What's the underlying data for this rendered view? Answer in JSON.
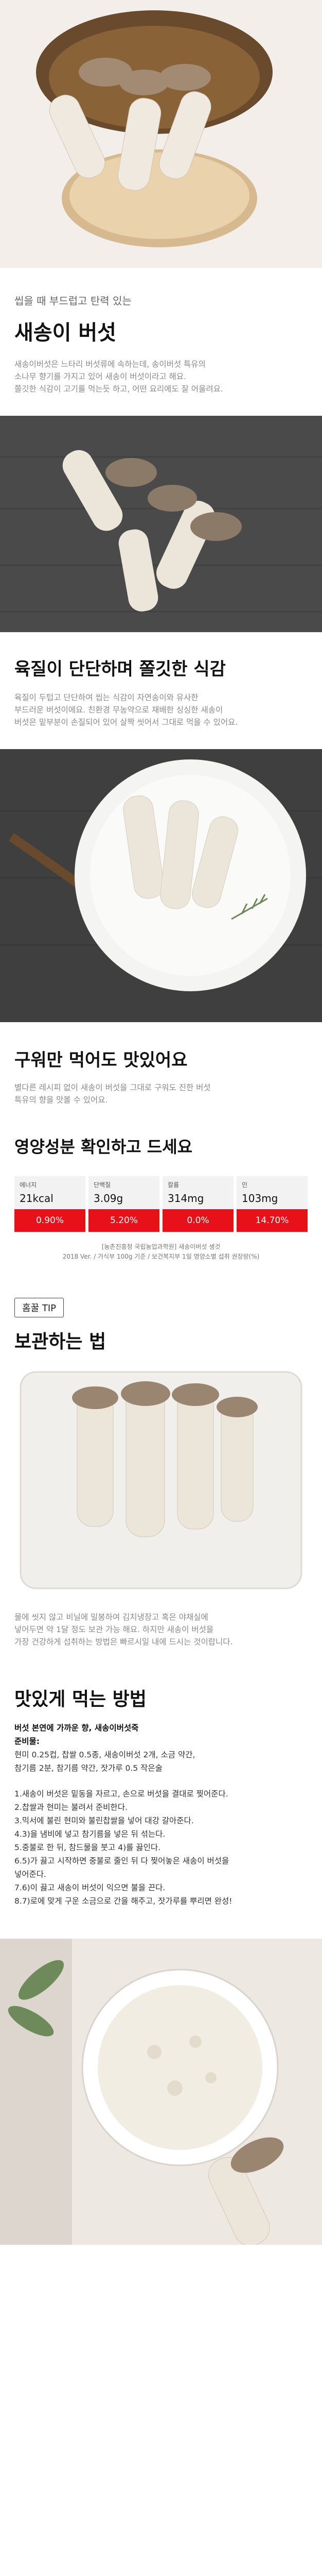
{
  "intro": {
    "subtitle": "씹을 때 부드럽고 탄력 있는",
    "title": "새송이 버섯",
    "desc": [
      "새송이버섯은 느타리 버섯류에 속하는데, 송이버섯 특유의",
      "소나무 향기를 가지고 있어 새송이 버섯이라고 해요.",
      "쫄깃한 식감이 고기를 먹는듯 하고, 어떤 요리에도 잘 어울려요."
    ]
  },
  "texture": {
    "title": "육질이 단단하며 쫄깃한 식감",
    "desc": [
      "육질이 두텁고 단단하여 씹는 식감이 자연송이와 유사한",
      "부드러운 버섯이에요. 친환경 무농약으로 재배한 싱싱한 새송이",
      "버섯은 밑부분이 손질되어 있어 살짝 씻어서 그대로 먹을 수 있어요."
    ]
  },
  "grill": {
    "title": "구워만 먹어도 맛있어요",
    "desc": [
      "별다른 레시피 없이 새송이 버섯을 그대로 구워도 진한 버섯",
      "특유의 향을 맛볼 수 있어요."
    ]
  },
  "nutrition": {
    "title": "영양성분 확인하고 드세요",
    "items": [
      {
        "label": "에너지",
        "value": "21kcal",
        "pct": "0.90%"
      },
      {
        "label": "단백질",
        "value": "3.09g",
        "pct": "5.20%"
      },
      {
        "label": "칼륨",
        "value": "314mg",
        "pct": "0.0%"
      },
      {
        "label": "인",
        "value": "103mg",
        "pct": "14.70%"
      }
    ],
    "note": [
      "[농촌진흥청 국립농업과학원] 새송이버섯 생것",
      "2018 Ver. / 가식부 100g 기준 / 보건복지부 1일 영양소별 섭취 권장량(%)"
    ]
  },
  "storage": {
    "badge": "홈꿀 TIP",
    "title": "보관하는 법",
    "desc": [
      "물에 씻지 않고 비닐에 밀봉하여 김치냉장고 혹은 야채실에",
      "넣어두면 약 1달 정도 보관 가능 해요. 하지만 새송이 버섯을",
      "가장 건강하게 섭취하는 방법은 빠르시일 내에 드시는 것이랍니다."
    ]
  },
  "recipe": {
    "title": "맛있게 먹는 방법",
    "name": "버섯 본연에 가까운 향, 새송이버섯죽",
    "ingredients_label": "준비물:",
    "ingredients": [
      "현미 0.25컵, 찹쌀 0.5종, 새송이버섯 2개, 소금 약간,",
      "참기름 2분, 참기름 약간, 잣가루 0.5 작은술"
    ],
    "steps": [
      "1.새송이 버섯은 밑동을 자르고, 손으로 버섯을 결대로 찢어준다.",
      "2.찹쌀과 현미는 불려서 준비한다.",
      "3.믹서에 불린 현미와 불린찹쌀을 넣어 대강 갈아준다.",
      "4.3)을 냄비에 넣고 참기름을 넣은 뒤 섞는다.",
      "5.중불로 한 뒤, 참드물을 붓고 4)를 끓인다.",
      "6.5)가 끓고 시작하면 중불로 줄인 뒤 다 찢어놓은 새송이 버섯을",
      "넣어준다.",
      "7.6)이 끓고 새송이 버섯이 익으면 불을 끈다.",
      "8.7)로에 맞게 구운 소금으로 간을 해주고, 잣가루를 뿌리면 완성!"
    ]
  },
  "colors": {
    "accent": "#e8111a",
    "grey_bg": "#f2f2f2",
    "dark_photo": "#4a4a4a"
  }
}
